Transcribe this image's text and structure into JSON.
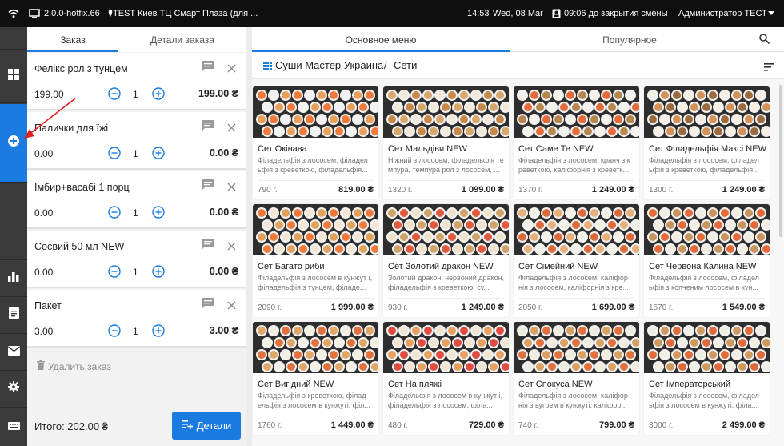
{
  "topbar": {
    "version": "2.0.0-hotfix.66",
    "location": "TEST Киев ТЦ Смарт Плаза (для ...",
    "time": "14:53",
    "date": "Wed, 08 Mar",
    "shift_close": "09:06 до закрытия смены",
    "user": "Администратор ТЕСТ"
  },
  "sidebar": {
    "items": [
      {
        "name": "wifi-icon"
      },
      {
        "name": "grid-icon"
      },
      {
        "name": "add-circle-icon"
      },
      {
        "name": "bar-chart-icon"
      },
      {
        "name": "receipt-icon"
      },
      {
        "name": "mail-icon"
      },
      {
        "name": "gear-icon"
      },
      {
        "name": "keyboard-icon"
      }
    ]
  },
  "order": {
    "tabs": [
      "Заказ",
      "Детали заказа"
    ],
    "items": [
      {
        "name": "Фелікс рол з тунцем",
        "price": "199.00",
        "qty": "1",
        "total": "199.00 ₴"
      },
      {
        "name": "Палички для їжі",
        "price": "0.00",
        "qty": "1",
        "total": "0.00 ₴"
      },
      {
        "name": "Імбир+васабі 1 порц",
        "price": "0.00",
        "qty": "1",
        "total": "0.00 ₴"
      },
      {
        "name": "Соєвий 50 мл NEW",
        "price": "0.00",
        "qty": "1",
        "total": "0.00 ₴"
      },
      {
        "name": "Пакет",
        "price": "3.00",
        "qty": "1",
        "total": "3.00 ₴"
      }
    ],
    "delete_label": "Удалить заказ",
    "total_label": "Итого: 202.00 ₴",
    "details_button": "Детали"
  },
  "menu": {
    "tabs": [
      "Основное меню",
      "Популярное"
    ],
    "breadcrumb": {
      "root": "Суши Мастер Украина",
      "sep": "/",
      "current": "Сети"
    },
    "cards": [
      {
        "title": "Сет Окінава",
        "desc": "Філадельфія з лососем, філадел ьфія з креветкою, філадельфія...",
        "weight": "790 г.",
        "price": "819.00 ₴"
      },
      {
        "title": "Сет Мальдіви NEW",
        "desc": "Ніжний з лососем, філадельфія те мпура, темпура рол з лососем, ...",
        "weight": "1320 г.",
        "price": "1 099.00 ₴"
      },
      {
        "title": "Сет Саме Те NEW",
        "desc": "Філадельфія з лососем, кранч з к реветкою, каліфорнія з креветк...",
        "weight": "1370 г.",
        "price": "1 249.00 ₴"
      },
      {
        "title": "Сет Філадельфія Максі NEW",
        "desc": "Філадельфія з лососем, філадел ьфія з креветкою, філадельфія...",
        "weight": "1300 г.",
        "price": "1 249.00 ₴"
      },
      {
        "title": "Сет Багато риби",
        "desc": "Філадельфія з лососем в кунжут і, філадельфія з тунцем, філаде...",
        "weight": "2090 г.",
        "price": "1 999.00 ₴"
      },
      {
        "title": "Сет Золотий дракон NEW",
        "desc": "Золотий дракон, червоний дракон, філадельфія з креветкою, су...",
        "weight": "930 г.",
        "price": "1 249.00 ₴"
      },
      {
        "title": "Сет Сімейний NEW",
        "desc": "Філадельфія з лососем, каліфор нія з лососем, каліфорнія з кре...",
        "weight": "2050 г.",
        "price": "1 699.00 ₴"
      },
      {
        "title": "Сет Червона Калина NEW",
        "desc": "Філадельфія з лососем, філадел ьфія з копченим лососем в кун...",
        "weight": "1570 г.",
        "price": "1 549.00 ₴"
      },
      {
        "title": "Сет Вигідний NEW",
        "desc": "Філадельфія з креветкою, філад ельфія з лососем в кунжуті, філ...",
        "weight": "1760 г.",
        "price": "1 449.00 ₴"
      },
      {
        "title": "Сет На пляжі",
        "desc": "Філадельфія з лососем в кунжут і, філадельфія з лососем, філа...",
        "weight": "480 г.",
        "price": "729.00 ₴"
      },
      {
        "title": "Сет Спокуса NEW",
        "desc": "Філадельфія з лососем, каліфор нія з вугрем в кунжуті, каліфор...",
        "weight": "740 г.",
        "price": "799.00 ₴"
      },
      {
        "title": "Сет Імператорський",
        "desc": "Філадельфія з лососем, філадел ьфія з лососем в кунжуті, філа...",
        "weight": "3000 г.",
        "price": "2 499.00 ₴"
      }
    ]
  },
  "colors": {
    "accent": "#1a7be0",
    "topbar": "#0f0f0f",
    "sidebar": "#3b3b3b",
    "annotation_arrow": "#e02020"
  }
}
